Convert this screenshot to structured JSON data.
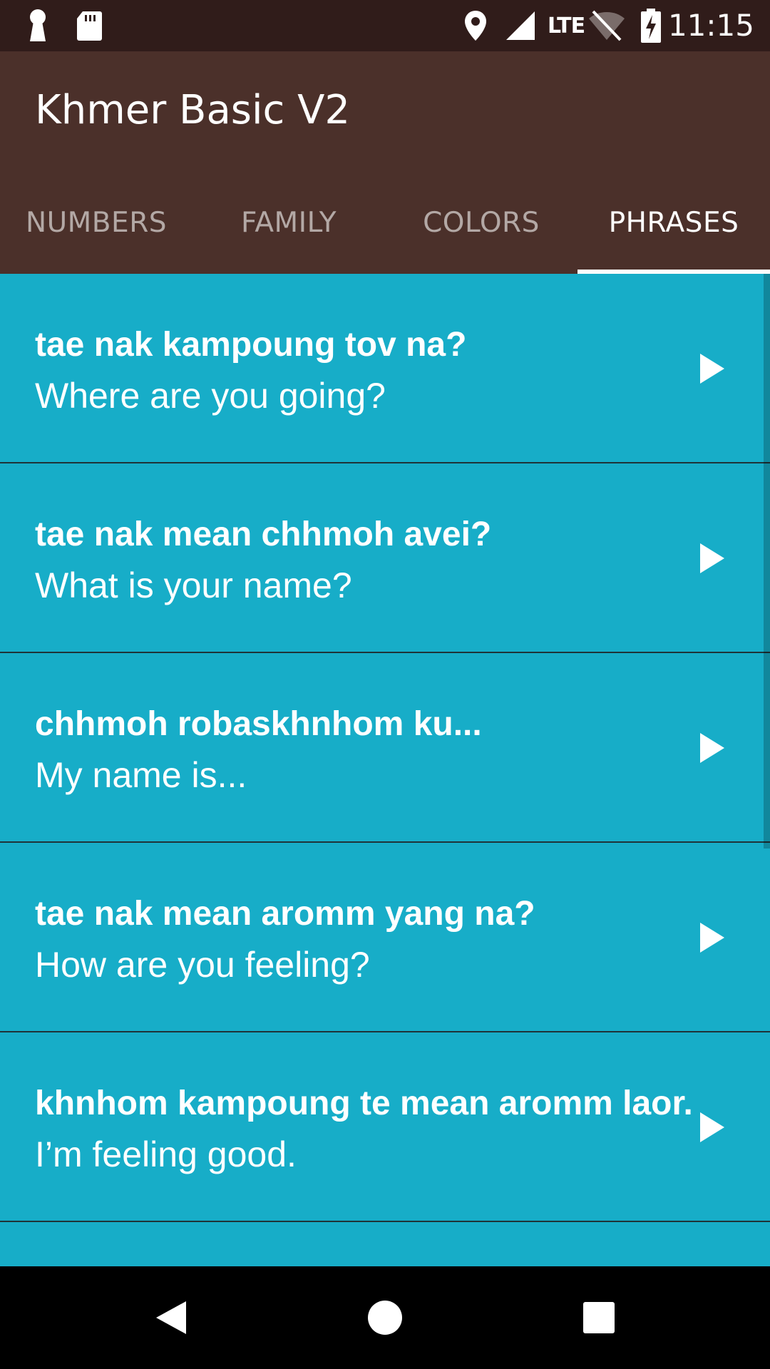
{
  "status_bar": {
    "time": "11:15",
    "network": "LTE",
    "icons": [
      "keyhole-icon",
      "sd-card-icon",
      "location-icon",
      "signal-icon",
      "wifi-off-icon",
      "battery-charging-icon"
    ]
  },
  "app": {
    "title": "Khmer Basic V2"
  },
  "tabs": [
    {
      "label": "NUMBERS",
      "active": false
    },
    {
      "label": "FAMILY",
      "active": false
    },
    {
      "label": "COLORS",
      "active": false
    },
    {
      "label": "PHRASES",
      "active": true
    }
  ],
  "phrases": [
    {
      "khmer": "tae nak kampoung tov na?",
      "english": "Where are you going?"
    },
    {
      "khmer": "tae nak mean chhmoh avei?",
      "english": "What is your name?"
    },
    {
      "khmer": "chhmoh robaskhnhom ku...",
      "english": "My name is..."
    },
    {
      "khmer": "tae nak mean aromm yang na?",
      "english": "How are you feeling?"
    },
    {
      "khmer": "khnhom kampoung te mean aromm laor.",
      "english": "I’m feeling good."
    }
  ],
  "colors": {
    "status_bar": "#301c1a",
    "app_bar": "#4b302a",
    "list_item": "#17adc8",
    "divider": "#1f3338"
  }
}
